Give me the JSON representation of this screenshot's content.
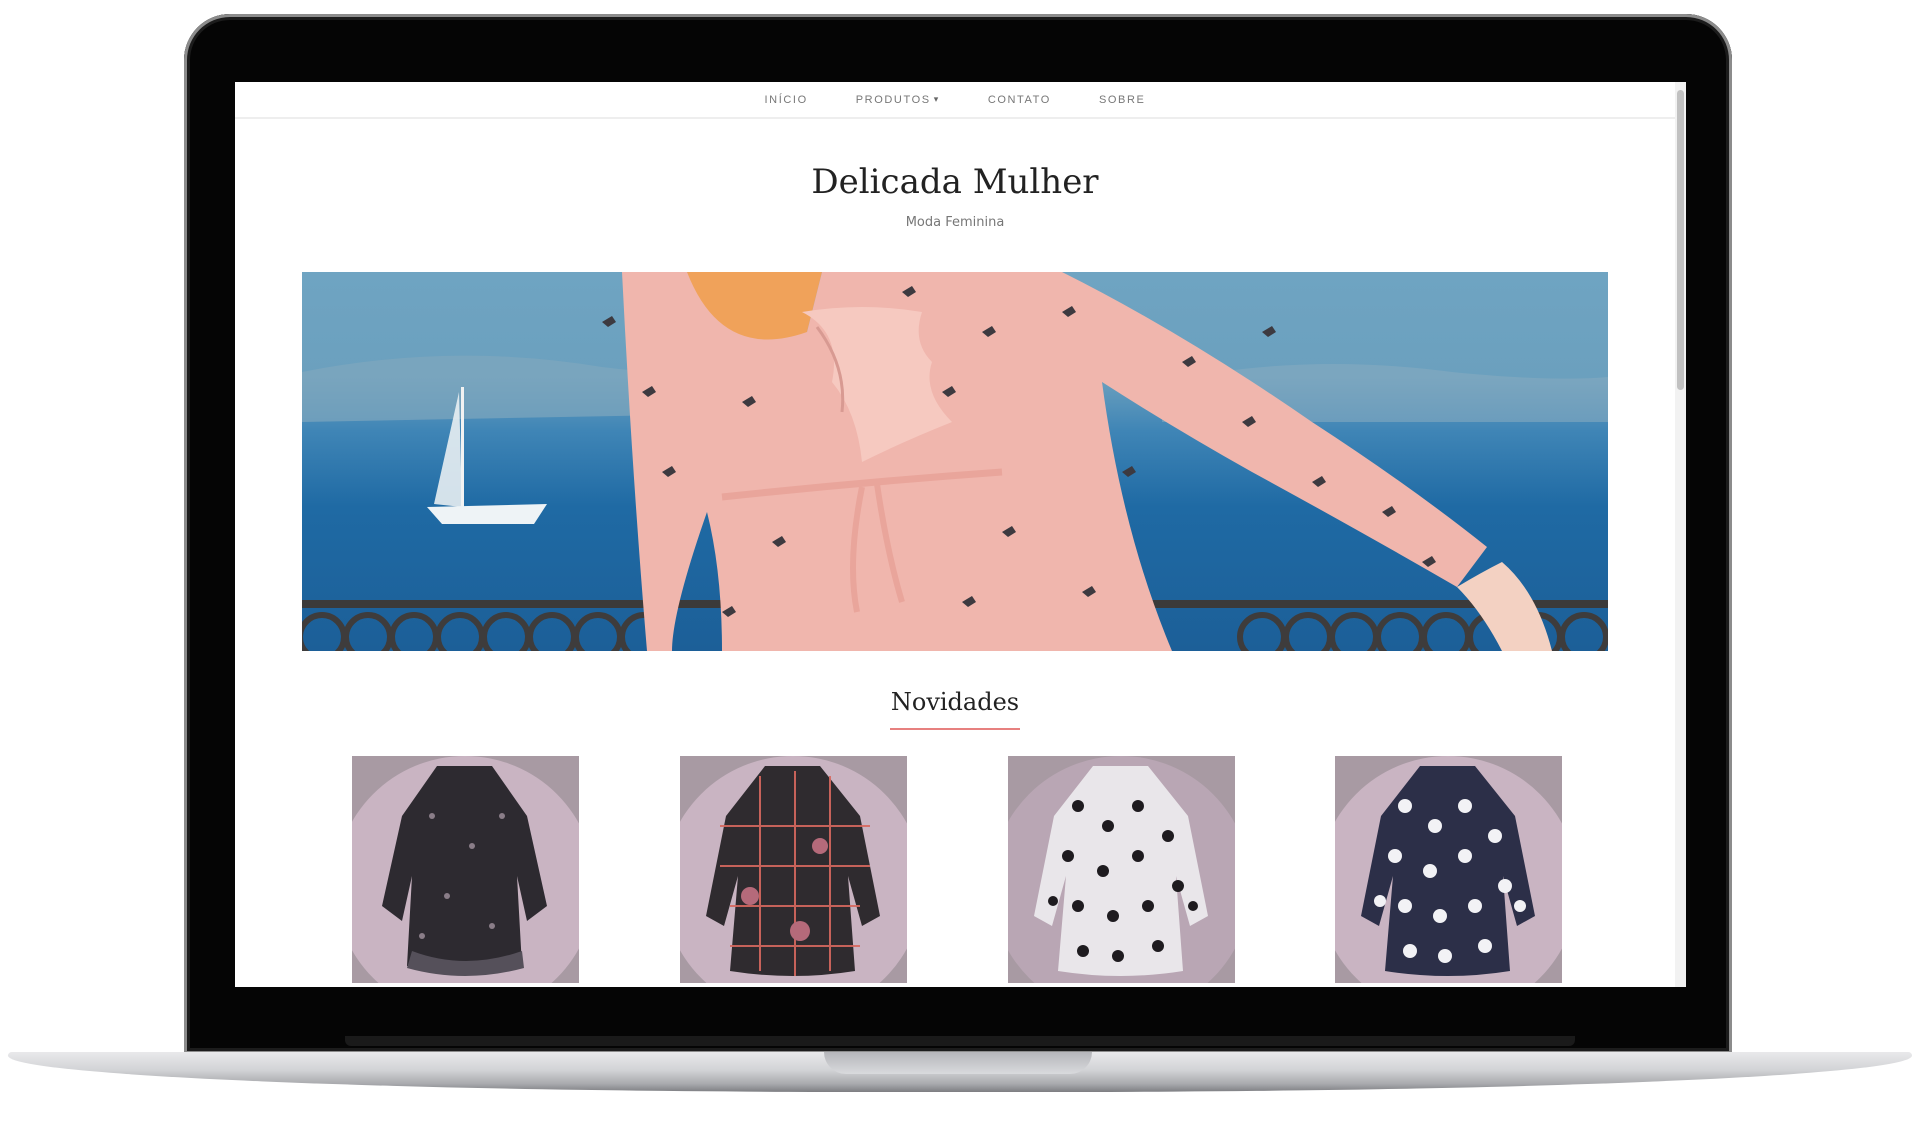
{
  "nav": {
    "items": [
      {
        "label": "INÍCIO"
      },
      {
        "label": "PRODUTOS",
        "has_dropdown": true
      },
      {
        "label": "CONTATO"
      },
      {
        "label": "SOBRE"
      }
    ]
  },
  "site": {
    "title": "Delicada Mulher",
    "tagline": "Moda Feminina"
  },
  "hero": {
    "image": "woman-in-pink-bird-print-dress-by-sea"
  },
  "section": {
    "title": "Novidades",
    "accent_color": "#e7807f"
  },
  "products": [
    {
      "image": "black-floral-dress"
    },
    {
      "image": "plaid-floral-dress"
    },
    {
      "image": "white-polka-dot-dress"
    },
    {
      "image": "navy-polka-dot-dress"
    }
  ]
}
